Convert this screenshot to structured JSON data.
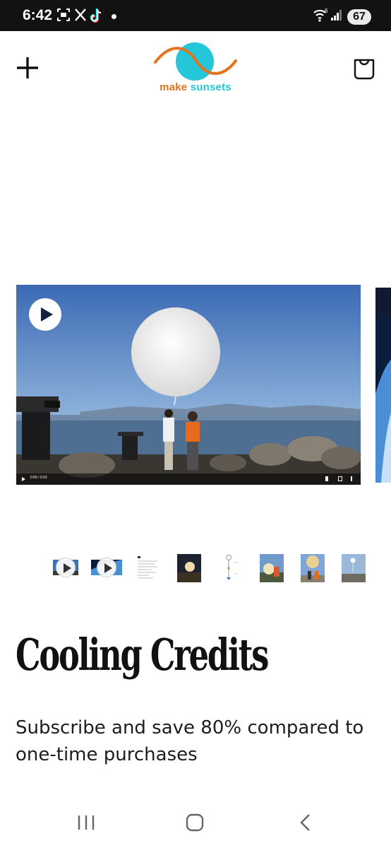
{
  "status_bar": {
    "time": "6:42",
    "battery": "67",
    "icons": [
      "screenshot-icon",
      "x-icon",
      "tiktok-icon",
      "notification-dot",
      "wifi-icon",
      "signal-icon",
      "battery-icon"
    ]
  },
  "header": {
    "logo_word1": "make",
    "logo_word2": "sunsets",
    "colors": {
      "orange": "#e2731f",
      "cyan": "#25c6d9"
    },
    "icons": {
      "menu": "plus-icon",
      "cart": "bag-icon"
    }
  },
  "video": {
    "time_display": "0:00 / 0:53"
  },
  "product": {
    "title": "Cooling Credits",
    "subtitle": "Subscribe and save 80% compared to one-time purchases"
  },
  "thumbnails": [
    {
      "kind": "video"
    },
    {
      "kind": "video"
    },
    {
      "kind": "document"
    },
    {
      "kind": "photo"
    },
    {
      "kind": "diagram"
    },
    {
      "kind": "photo"
    },
    {
      "kind": "photo"
    },
    {
      "kind": "photo"
    }
  ],
  "nav": {
    "icons": [
      "recent-apps-icon",
      "home-icon",
      "back-icon"
    ]
  }
}
